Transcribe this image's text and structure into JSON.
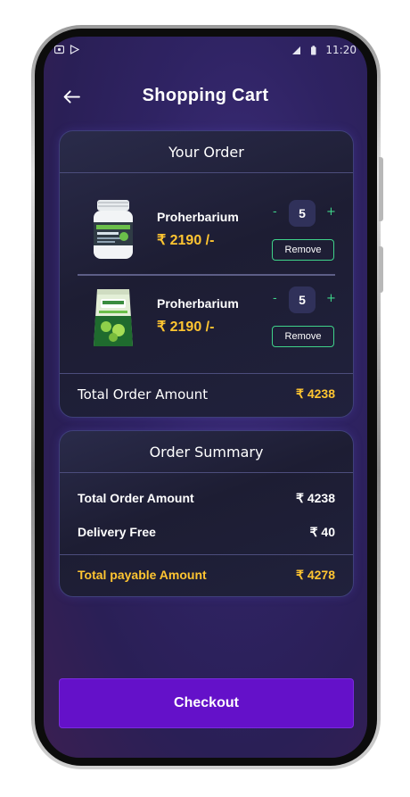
{
  "status_bar": {
    "time": "11:20"
  },
  "header": {
    "title": "Shopping Cart"
  },
  "order": {
    "title": "Your Order",
    "items": [
      {
        "name": "Proherbarium",
        "price": "₹ 2190 /-",
        "quantity": "5",
        "remove_label": "Remove",
        "minus": "-",
        "plus": "+"
      },
      {
        "name": "Proherbarium",
        "price": "₹ 2190 /-",
        "quantity": "5",
        "remove_label": "Remove",
        "minus": "-",
        "plus": "+"
      }
    ],
    "total_label": "Total Order Amount",
    "total_value": "₹ 4238"
  },
  "summary": {
    "title": "Order Summary",
    "rows": [
      {
        "label": "Total Order Amount",
        "value": "₹ 4238"
      },
      {
        "label": "Delivery Free",
        "value": "₹ 40"
      }
    ],
    "payable_label": "Total payable Amount",
    "payable_value": "₹ 4278"
  },
  "checkout": {
    "label": "Checkout"
  },
  "colors": {
    "accent": "#ffc531",
    "qty_green": "#3fd38a",
    "checkout": "#6411c9",
    "card_bg": "#1d1d33"
  },
  "icons": {
    "back": "arrow-left-icon",
    "product_1": "product-bottle-icon",
    "product_2": "product-pouch-icon"
  }
}
